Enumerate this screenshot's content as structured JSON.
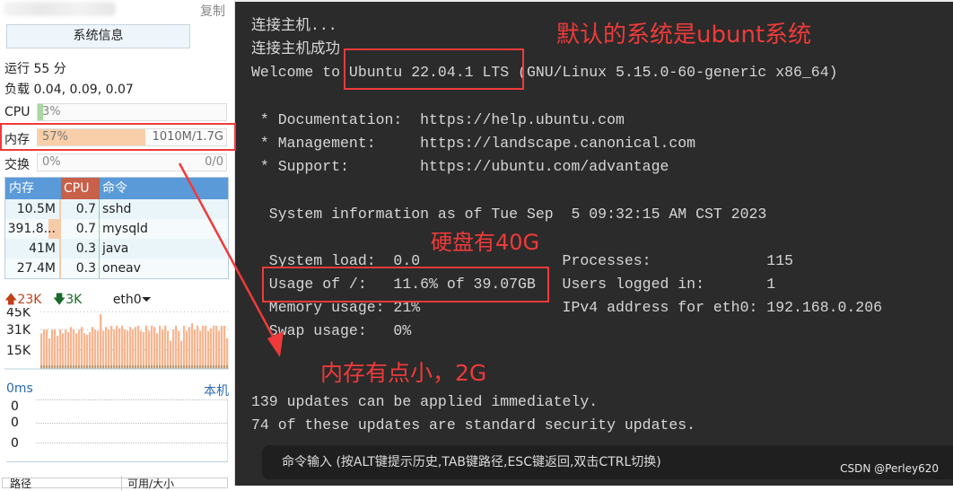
{
  "sidebar": {
    "copy_label": "复制",
    "sysinfo_button": "系统信息",
    "uptime": "运行 55 分",
    "load": "负载 0.04, 0.09, 0.07",
    "cpu": {
      "label": "CPU",
      "percent_text": "3%",
      "percent": 3
    },
    "memory": {
      "label": "内存",
      "percent_text": "57%",
      "percent": 57,
      "usage": "1010M/1.7G"
    },
    "swap": {
      "label": "交换",
      "percent_text": "0%",
      "percent": 0,
      "usage": "0/0"
    },
    "process_table": {
      "headers": [
        "内存",
        "CPU",
        "命令"
      ],
      "rows": [
        [
          "10.5M",
          "0.7",
          "sshd"
        ],
        [
          "391.8...",
          "0.7",
          "mysqld"
        ],
        [
          "41M",
          "0.3",
          "java"
        ],
        [
          "27.4M",
          "0.3",
          "oneav"
        ]
      ]
    },
    "network": {
      "upload": "23K",
      "download": "3K",
      "interface": "eth0",
      "y_ticks": [
        "45K",
        "31K",
        "15K"
      ],
      "upload_bars": [
        28,
        31,
        31,
        24,
        31,
        31,
        26,
        31,
        28,
        31,
        29,
        33,
        31,
        28,
        31,
        33,
        28,
        27,
        29,
        33,
        31,
        30,
        43,
        30,
        33,
        31,
        34,
        31,
        34,
        32,
        34,
        31,
        30,
        33,
        31,
        33,
        34,
        30,
        29,
        34,
        30,
        34,
        33,
        28,
        34,
        31,
        34,
        30,
        22,
        31,
        34,
        30,
        22,
        34,
        30,
        33,
        36,
        31,
        34,
        30,
        34,
        34,
        30,
        32,
        34,
        34,
        30,
        34,
        34,
        24
      ],
      "colors": {
        "upload": "#f9b58f",
        "download": "#a89068"
      }
    },
    "ping": {
      "latency": "0ms",
      "target": "本机",
      "values": [
        "0",
        "0",
        "0"
      ]
    },
    "disk_table": {
      "headers": [
        "路径",
        "可用/大小"
      ]
    }
  },
  "terminal": {
    "lines": [
      "连接主机...",
      "连接主机成功",
      "Welcome to Ubuntu 22.04.1 LTS (GNU/Linux 5.15.0-60-generic x86_64)",
      "",
      " * Documentation:  https://help.ubuntu.com",
      " * Management:     https://landscape.canonical.com",
      " * Support:        https://ubuntu.com/advantage",
      "",
      "  System information as of Tue Sep  5 09:32:15 AM CST 2023",
      "",
      "  System load:  0.0                Processes:             115",
      "  Usage of /:   11.6% of 39.07GB   Users logged in:       1",
      "  Memory usage: 21%                IPv4 address for eth0: 192.168.0.206",
      "  Swap usage:   0%",
      "",
      "",
      "139 updates can be applied immediately.",
      "74 of these updates are standard security updates."
    ],
    "command_placeholder": "命令输入 (按ALT键提示历史,TAB键路径,ESC键返回,双击CTRL切换)"
  },
  "annotations": {
    "default_system": "默认的系统是ubunt系统",
    "disk": "硬盘有40G",
    "memory": "内存有点小，2G",
    "color": "#f03a3a"
  },
  "watermark": "CSDN @Perley620"
}
